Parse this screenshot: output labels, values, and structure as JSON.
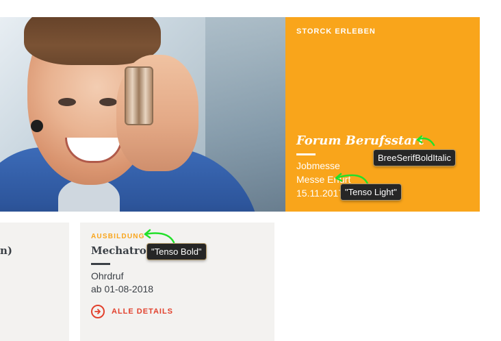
{
  "promo": {
    "eyebrow": "STORCK ERLEBEN",
    "title": "Forum Berufsstart",
    "lines": [
      "Jobmesse",
      "Messe Erfurt",
      "15.11.2017"
    ],
    "background_color": "#f9a51b"
  },
  "left_card": {
    "title_fragment": "n)"
  },
  "job_card": {
    "category": "AUSBILDUNG",
    "title": "Mechatroniker/in",
    "location": "Ohrdruf",
    "date": "ab 01-08-2018",
    "details_label": "ALLE DETAILS",
    "details_icon": "arrow-right-circle-icon",
    "accent_color": "#e2402c",
    "category_color": "#f9a51b"
  },
  "annotations": [
    {
      "label": "BreeSerifBoldItalic"
    },
    {
      "label": "\"Tenso Light\""
    },
    {
      "label": "\"Tenso Bold\""
    }
  ],
  "annotation_arrow_color": "#22e02a"
}
